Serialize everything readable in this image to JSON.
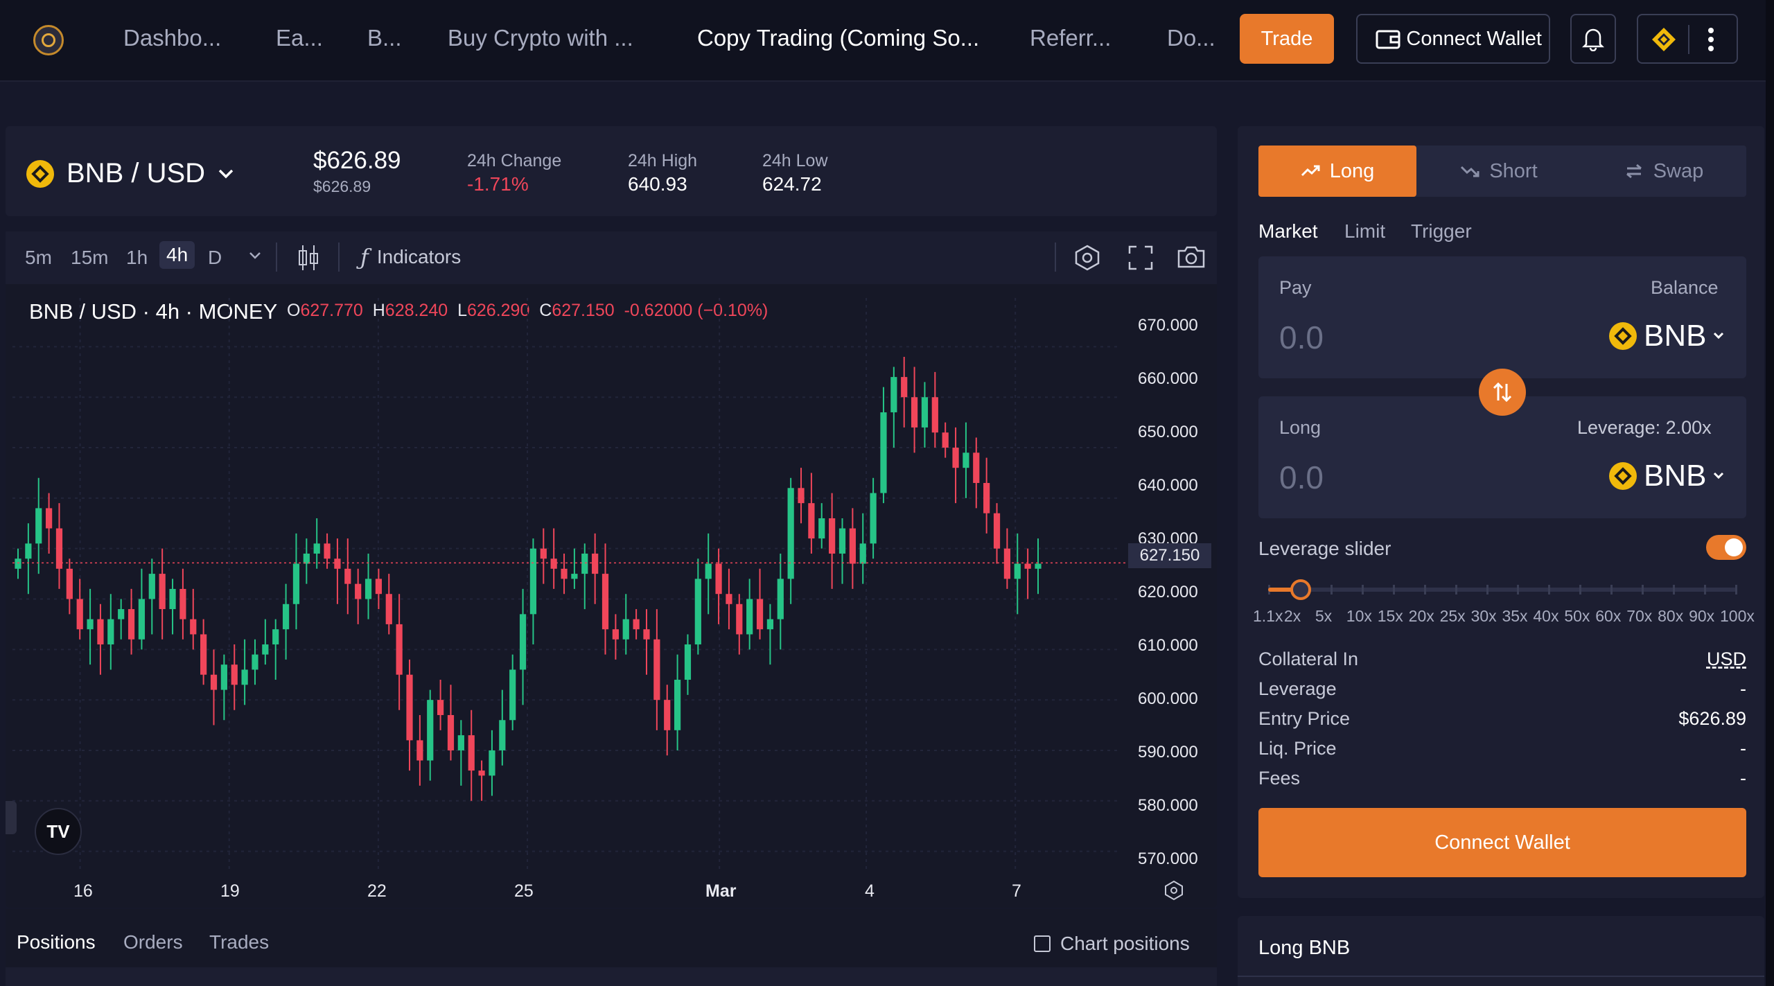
{
  "nav": {
    "items": [
      "Dashbo...",
      "Ea...",
      "B...",
      "Buy Crypto with ...",
      "Copy Trading (Coming So...",
      "Referr...",
      "Do..."
    ],
    "active_index": 4,
    "trade_label": "Trade",
    "connect_wallet_label": "Connect Wallet"
  },
  "ticker": {
    "pair": "BNB / USD",
    "price": "$626.89",
    "price_sub": "$626.89",
    "change_label": "24h Change",
    "change_value": "-1.71%",
    "high_label": "24h High",
    "high_value": "640.93",
    "low_label": "24h Low",
    "low_value": "624.72"
  },
  "toolbar": {
    "timeframes": [
      "5m",
      "15m",
      "1h",
      "4h",
      "D"
    ],
    "selected_timeframe": "4h",
    "indicators_label": "Indicators"
  },
  "chart_header": {
    "title": "BNB / USD · 4h · MONEY",
    "o_label": "O",
    "o_value": "627.770",
    "h_label": "H",
    "h_value": "628.240",
    "l_label": "L",
    "l_value": "626.290",
    "c_label": "C",
    "c_value": "627.150",
    "change": "-0.62000 (−0.10%)"
  },
  "chart_data": {
    "type": "candlestick",
    "ylim": [
      565,
      675
    ],
    "y_ticks": [
      "670.000",
      "660.000",
      "650.000",
      "640.000",
      "630.000",
      "620.000",
      "610.000",
      "600.000",
      "590.000",
      "580.000",
      "570.000"
    ],
    "x_ticks": [
      "16",
      "19",
      "22",
      "25",
      "Mar",
      "4",
      "7"
    ],
    "last_price": "627.150",
    "closes": [
      628,
      631,
      638,
      634,
      626,
      620,
      614,
      616,
      611,
      616,
      618,
      612,
      620,
      625,
      618,
      622,
      616,
      613,
      605,
      602,
      607,
      603,
      606,
      609,
      611,
      614,
      619,
      627,
      629,
      631,
      628,
      626,
      623,
      620,
      624,
      621,
      615,
      605,
      592,
      588,
      600,
      597,
      590,
      593,
      586,
      585,
      590,
      596,
      606,
      617,
      630,
      628,
      626,
      624,
      625,
      629,
      625,
      614,
      612,
      616,
      614,
      612,
      600,
      594,
      604,
      611,
      624,
      627,
      621,
      619,
      613,
      620,
      614,
      616,
      624,
      642,
      639,
      632,
      636,
      629,
      634,
      627,
      631,
      641,
      657,
      664,
      660,
      654,
      660,
      653,
      650,
      646,
      649,
      643,
      637,
      630,
      624,
      627,
      626,
      627
    ]
  },
  "bottom_tabs": {
    "items": [
      "Positions",
      "Orders",
      "Trades"
    ],
    "chart_positions_label": "Chart positions"
  },
  "trade_panel": {
    "sides": [
      "Long",
      "Short",
      "Swap"
    ],
    "order_types": [
      "Market",
      "Limit",
      "Trigger"
    ],
    "pay_label": "Pay",
    "balance_label": "Balance",
    "pay_value": "0.0",
    "pay_token": "BNB",
    "long_label": "Long",
    "leverage_label": "Leverage: 2.00x",
    "long_value": "0.0",
    "long_token": "BNB",
    "leverage_slider_label": "Leverage slider",
    "leverage_slider_enabled": true,
    "leverage_value": 2.0,
    "leverage_marks": [
      "1.1x",
      "2x",
      "5x",
      "10x",
      "15x",
      "20x",
      "25x",
      "30x",
      "35x",
      "40x",
      "50x",
      "60x",
      "70x",
      "80x",
      "90x",
      "100x"
    ],
    "info": [
      {
        "label": "Collateral In",
        "value": "USD"
      },
      {
        "label": "Leverage",
        "value": "-"
      },
      {
        "label": "Entry Price",
        "value": "$626.89"
      },
      {
        "label": "Liq. Price",
        "value": "-"
      },
      {
        "label": "Fees",
        "value": "-"
      }
    ],
    "connect_wallet_label": "Connect Wallet",
    "section_title": "Long BNB"
  },
  "colors": {
    "accent": "#e8792b",
    "up": "#26c487",
    "down": "#f0465a",
    "bg": "#16182a"
  }
}
